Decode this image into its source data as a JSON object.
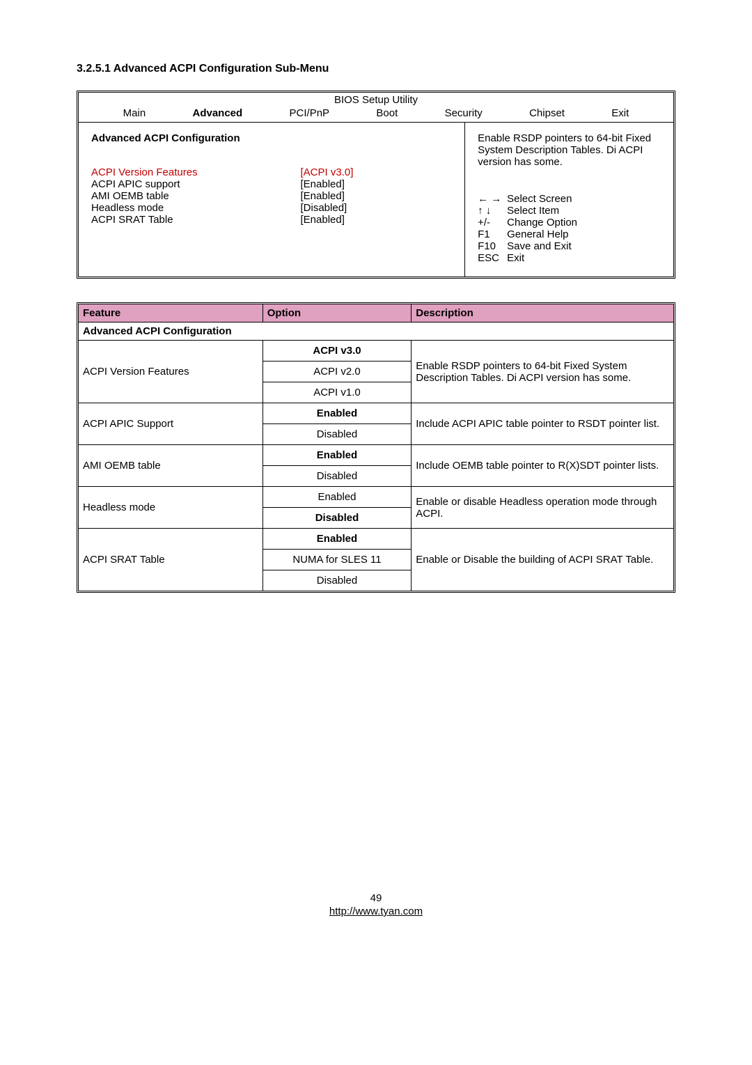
{
  "section_heading": "3.2.5.1 Advanced ACPI Configuration Sub-Menu",
  "bios": {
    "title": "BIOS Setup Utility",
    "menu": [
      "Main",
      "Advanced",
      "PCI/PnP",
      "Boot",
      "Security",
      "Chipset",
      "Exit"
    ],
    "active_menu": "Advanced",
    "subtitle": "Advanced ACPI Configuration",
    "items": [
      {
        "label": "ACPI Version Features",
        "value": "[ACPI v3.0]",
        "hl": true
      },
      {
        "label": "ACPI APIC support",
        "value": "[Enabled]",
        "hl": false
      },
      {
        "label": "AMI OEMB table",
        "value": "[Enabled]",
        "hl": false
      },
      {
        "label": "Headless mode",
        "value": "[Disabled]",
        "hl": false
      },
      {
        "label": "ACPI SRAT Table",
        "value": "[Enabled]",
        "hl": false
      }
    ],
    "help": "Enable RSDP pointers to 64-bit Fixed System Description Tables. Di ACPI version has some.",
    "keys": [
      {
        "k": "← →",
        "t": "Select Screen"
      },
      {
        "k": "↑  ↓",
        "t": "Select Item"
      },
      {
        "k": "+/-",
        "t": "Change Option"
      },
      {
        "k": "F1",
        "t": "General Help"
      },
      {
        "k": "F10",
        "t": "Save and Exit"
      },
      {
        "k": "ESC",
        "t": "Exit"
      }
    ]
  },
  "table": {
    "headers": [
      "Feature",
      "Option",
      "Description"
    ],
    "section": "Advanced ACPI Configuration",
    "rows": [
      {
        "feature": "ACPI Version Features",
        "options": [
          {
            "t": "ACPI v3.0",
            "b": true
          },
          {
            "t": "ACPI v2.0",
            "b": false
          },
          {
            "t": "ACPI v1.0",
            "b": false
          }
        ],
        "desc": "Enable RSDP pointers to 64-bit Fixed System Description Tables. Di ACPI version has some."
      },
      {
        "feature": "ACPI APIC Support",
        "options": [
          {
            "t": "Enabled",
            "b": true
          },
          {
            "t": "Disabled",
            "b": false
          }
        ],
        "desc": "Include ACPI APIC table pointer to RSDT pointer list."
      },
      {
        "feature": "AMI OEMB table",
        "options": [
          {
            "t": "Enabled",
            "b": true
          },
          {
            "t": "Disabled",
            "b": false
          }
        ],
        "desc": "Include OEMB table pointer to R(X)SDT pointer lists.",
        "justify": true
      },
      {
        "feature": "Headless mode",
        "options": [
          {
            "t": "Enabled",
            "b": false
          },
          {
            "t": "Disabled",
            "b": true
          }
        ],
        "desc": "Enable or disable Headless operation mode through ACPI."
      },
      {
        "feature": "ACPI SRAT Table",
        "options": [
          {
            "t": "Enabled",
            "b": true
          },
          {
            "t": "NUMA for SLES 11",
            "b": false
          },
          {
            "t": "Disabled",
            "b": false
          }
        ],
        "desc": "Enable or Disable the building of ACPI SRAT Table.",
        "justify": true
      }
    ]
  },
  "footer": {
    "page": "49",
    "url": "http://www.tyan.com"
  }
}
